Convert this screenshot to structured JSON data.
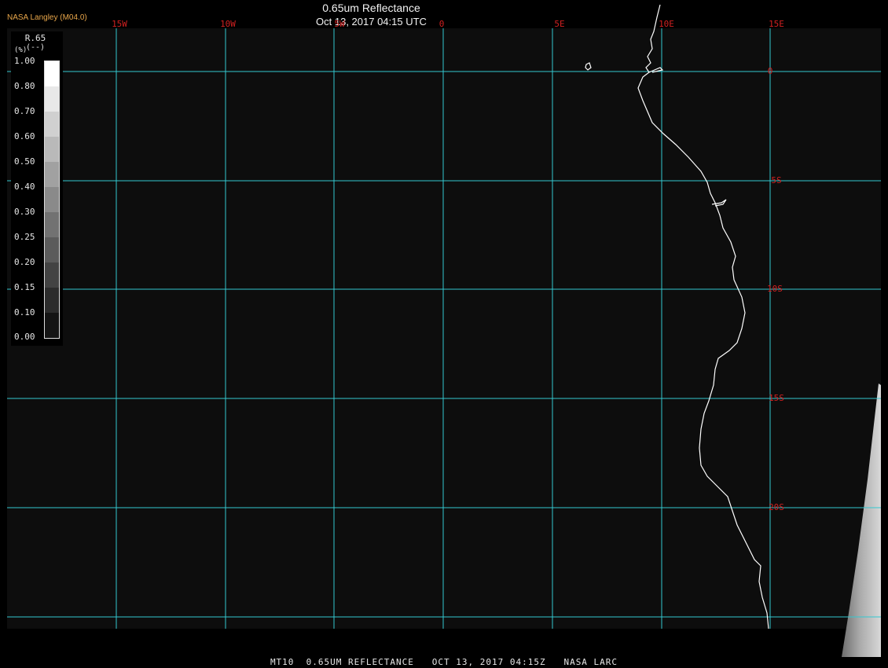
{
  "header": {
    "provider": "NASA Langley (M04.0)",
    "title": "0.65um Reflectance",
    "subtitle": "Oct 13, 2017 04:15 UTC"
  },
  "footer": {
    "text": "MT10  0.65UM REFLECTANCE   OCT 13, 2017 04:15Z   NASA LARC"
  },
  "legend": {
    "title": "R.65",
    "units": "(--)",
    "units_prefix": "(%)",
    "labels": [
      "1.00",
      "0.80",
      "0.70",
      "0.60",
      "0.50",
      "0.40",
      "0.30",
      "0.25",
      "0.20",
      "0.15",
      "0.10",
      "0.00"
    ]
  },
  "map": {
    "longitude_labels": [
      "15W",
      "10W",
      "5W",
      "0",
      "5E",
      "10E",
      "15E"
    ],
    "latitude_labels": [
      "0",
      "5S",
      "10S",
      "15S",
      "20S"
    ],
    "colors": {
      "grid": "#33c8d0",
      "grid_labels": "#d02020",
      "coastline": "#ffffff",
      "background": "#0d0d0d"
    }
  }
}
